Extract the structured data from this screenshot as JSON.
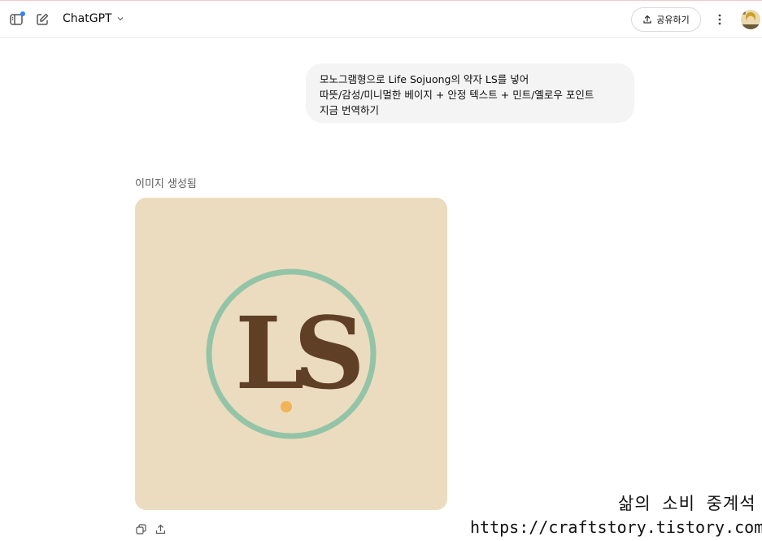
{
  "header": {
    "model_name": "ChatGPT",
    "share_label": "공유하기"
  },
  "conversation": {
    "user_message_lines": [
      "모노그램형으로 Life Sojuong의 약자 LS를 넣어",
      "따뜻/감성/미니멀한 베이지 + 안정 텍스트 + 민트/옐로우 포인트",
      "지금 번역하기"
    ],
    "image_status": "이미지 생성됨",
    "generated_image": {
      "monogram_text": "LS",
      "background_color": "#ecdcbf",
      "ring_color": "#94c4a7",
      "letter_color": "#603f27",
      "dot_color": "#f2b35a"
    }
  },
  "watermark": {
    "title": "삶의 소비 중계석",
    "url": "https://craftstory.tistory.com/"
  },
  "colors": {
    "accent_dot": "#2f86f7",
    "bubble_bg": "#f4f4f4"
  },
  "icons": [
    "sidebar-icon",
    "new-chat-icon",
    "chevron-down-icon",
    "share-icon",
    "more-vertical-icon",
    "copy-icon",
    "upload-icon"
  ]
}
